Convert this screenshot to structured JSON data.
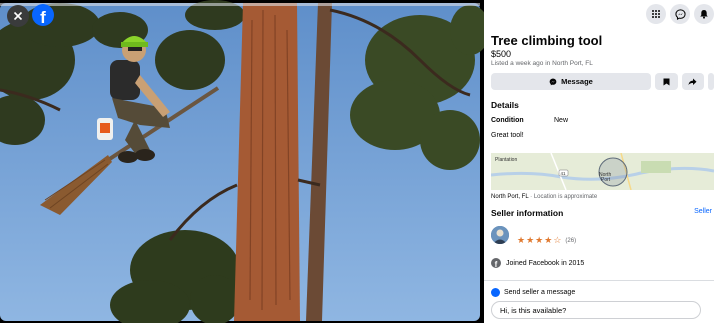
{
  "header": {
    "close_icon": "close-icon",
    "logo_letter": "f",
    "top_icons": [
      "grid-menu-icon",
      "messenger-icon",
      "bell-icon"
    ]
  },
  "listing": {
    "title": "Tree climbing tool",
    "price": "$500",
    "listed": "Listed a week ago in North Port, FL",
    "message_label": "Message"
  },
  "details": {
    "heading": "Details",
    "condition_label": "Condition",
    "condition_value": "New",
    "description": "Great tool!"
  },
  "map": {
    "label_plantation": "Plantation",
    "label_north_port_1": "North",
    "label_north_port_2": "Port",
    "road_label": "41"
  },
  "location": {
    "place": "North Port, FL",
    "separator": " · ",
    "approx": "Location is approximate"
  },
  "seller": {
    "heading": "Seller information",
    "link": "Seller",
    "stars": 4.5,
    "rating_count": "(26)",
    "joined": "Joined Facebook in 2015"
  },
  "compose": {
    "send_label": "Send seller a message",
    "input_value": "Hi, is this available?"
  },
  "colors": {
    "accent": "#0866ff",
    "star": "#e0792f",
    "button_bg": "#e4e6eb"
  }
}
